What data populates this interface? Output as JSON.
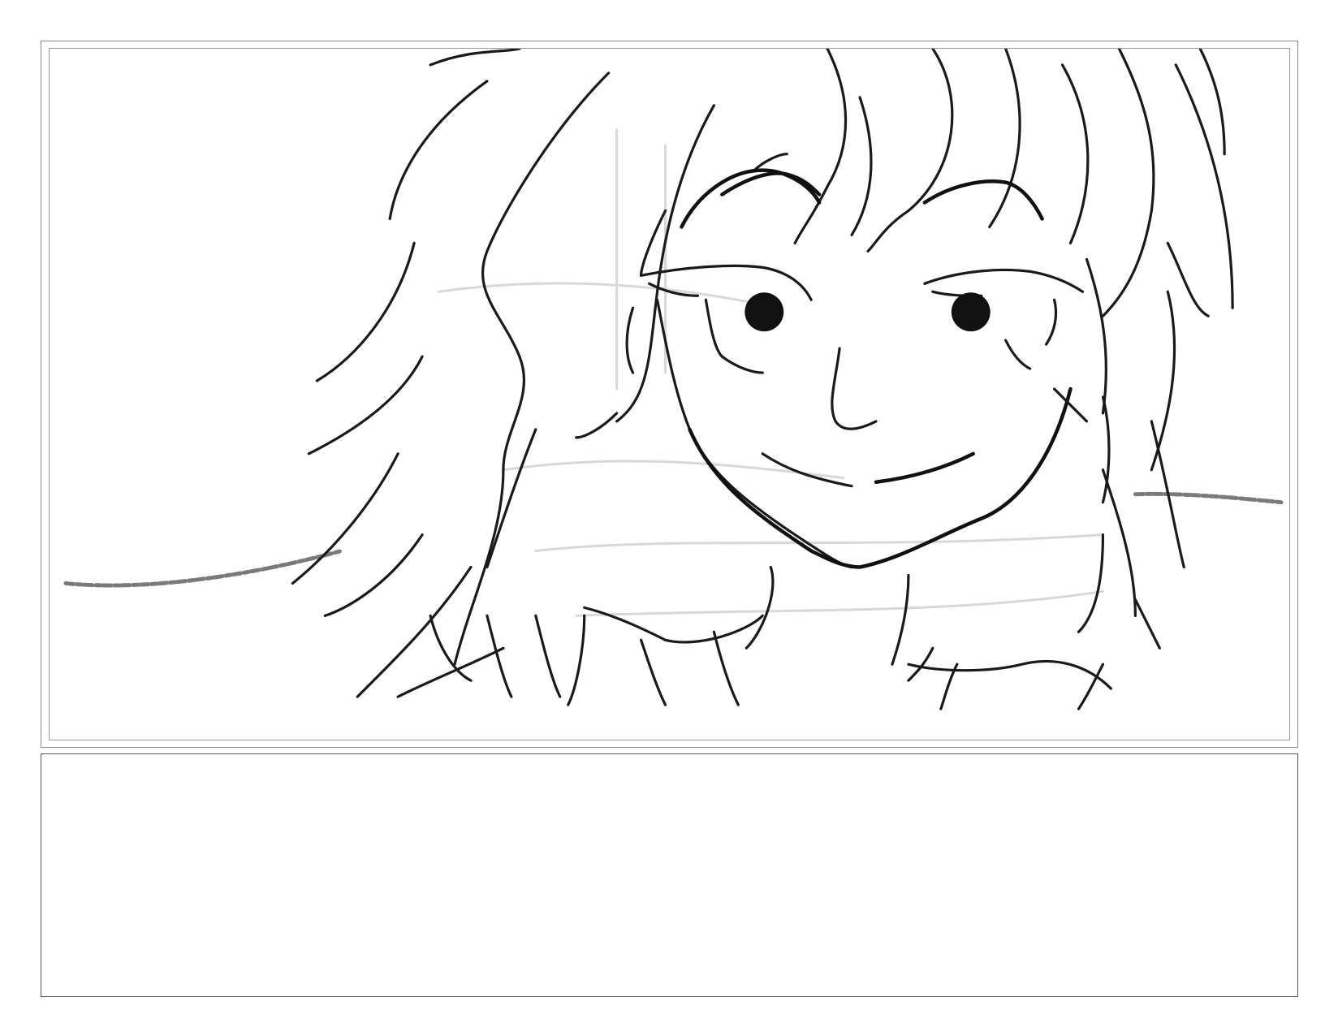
{
  "storyboard": {
    "panel": {
      "image": "girl-face-sketch"
    },
    "notes": {
      "text": ""
    }
  }
}
